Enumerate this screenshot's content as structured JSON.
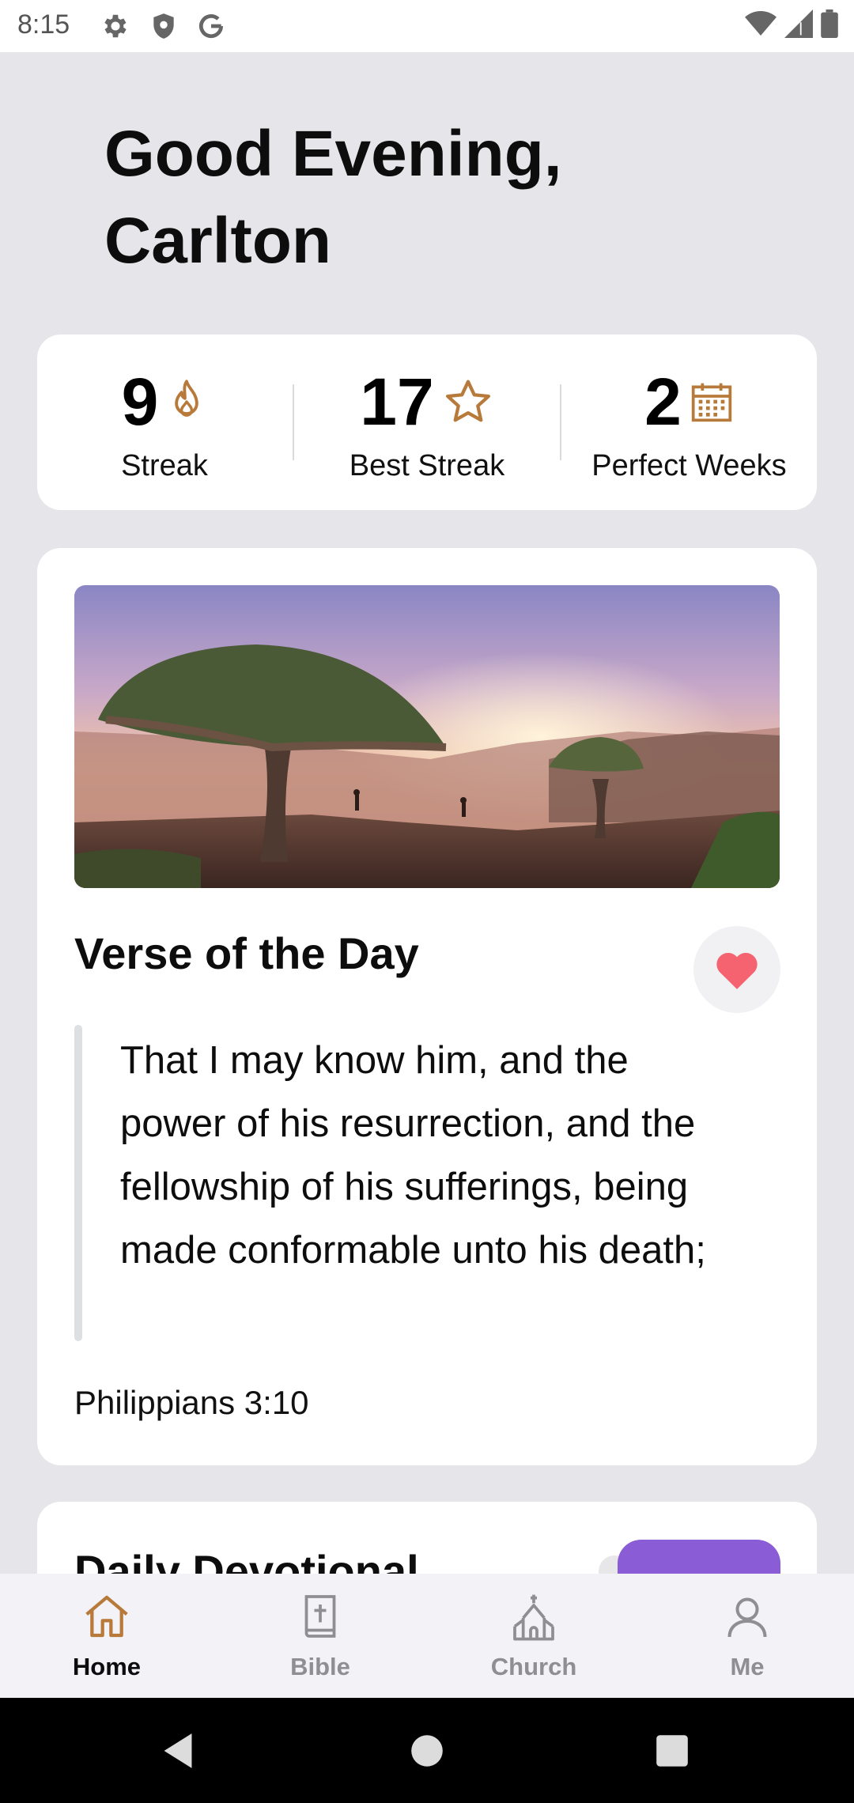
{
  "status_bar": {
    "time": "8:15",
    "icons_left": [
      "gear-icon",
      "shield-icon",
      "google-icon"
    ],
    "icons_right": [
      "wifi-icon",
      "signal-icon",
      "battery-icon"
    ]
  },
  "greeting": {
    "line1": "Good Evening,",
    "line2": "Carlton"
  },
  "stats": [
    {
      "value": "9",
      "label": "Streak",
      "icon": "flame-icon"
    },
    {
      "value": "17",
      "label": "Best Streak",
      "icon": "star-icon"
    },
    {
      "value": "2",
      "label": "Perfect Weeks",
      "icon": "calendar-icon"
    }
  ],
  "verse": {
    "title": "Verse of the Day",
    "text": "That I may know him, and the power of his resurrection, and the fellowship of his sufferings, being made conformable unto his death;",
    "reference": "Philippians 3:10",
    "favorite_icon": "heart-icon"
  },
  "devotional": {
    "title": "Daily Devotional"
  },
  "bottom_nav": [
    {
      "label": "Home",
      "icon": "home-icon",
      "active": true
    },
    {
      "label": "Bible",
      "icon": "bible-icon",
      "active": false
    },
    {
      "label": "Church",
      "icon": "church-icon",
      "active": false
    },
    {
      "label": "Me",
      "icon": "person-icon",
      "active": false
    }
  ],
  "colors": {
    "accent": "#B87A3A",
    "heart": "#F4636F",
    "devotional_button": "#8A5CD5",
    "background": "#E6E6EA"
  }
}
